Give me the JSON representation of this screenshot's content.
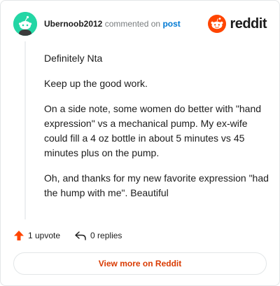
{
  "comment": {
    "author": "Ubernoob2012",
    "action_text": "commented on",
    "post_link_label": "post",
    "paragraphs": [
      "Definitely Nta",
      "Keep up the good work.",
      "On a side note, some women do better with \"hand expression\" vs a mechanical pump. My ex-wife could fill a 4 oz bottle in about 5 minutes vs 45 minutes plus on the pump.",
      "Oh, and thanks for my new favorite expression \"had the hump with me\". Beautiful"
    ],
    "upvote_label": "1 upvote",
    "replies_label": "0 replies",
    "view_more_label": "View more on Reddit"
  },
  "brand": {
    "name": "reddit",
    "logo_icon": "reddit-snoo-icon",
    "accent": "#ff4500"
  },
  "colors": {
    "avatar": "#24d6a5",
    "link": "#0079d3",
    "upvote": "#ff4500",
    "view_more": "#d93a00"
  }
}
